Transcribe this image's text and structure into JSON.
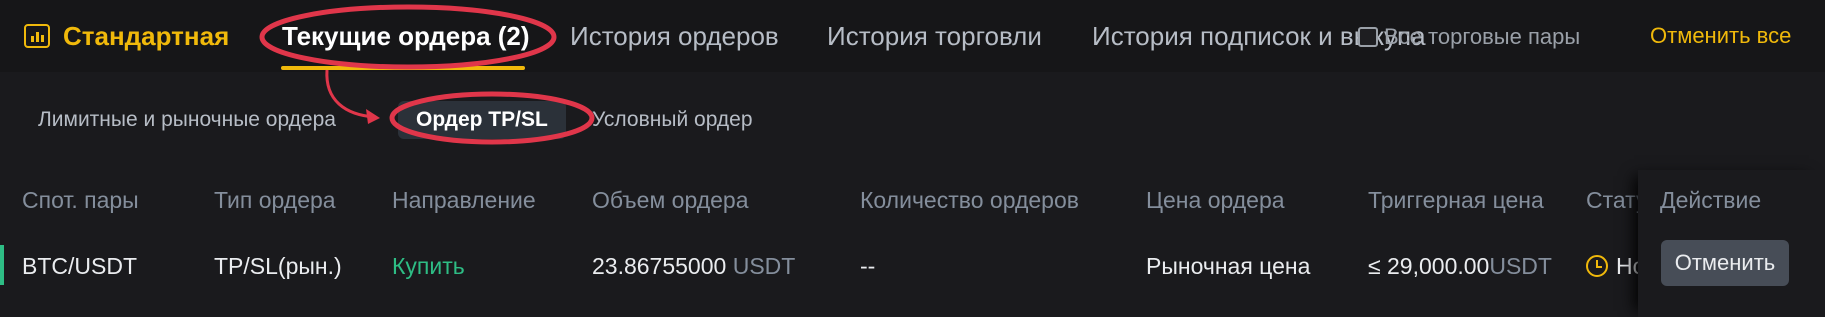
{
  "header": {
    "brand_icon": "chart-bars-icon",
    "brand_label": "Стандартная",
    "tabs": [
      {
        "label": "Текущие ордера (2)",
        "active": true
      },
      {
        "label": "История ордеров",
        "active": false
      },
      {
        "label": "История торговли",
        "active": false
      },
      {
        "label": "История подписок и выкупа",
        "active": false
      }
    ],
    "hide_pairs_label": "Все торговые пары",
    "cancel_all_label": "Отменить все"
  },
  "subtabs": [
    {
      "label": "Лимитные и рыночные ордера",
      "active": false
    },
    {
      "label": "Ордер TP/SL",
      "active": true
    },
    {
      "label": "Условный ордер",
      "active": false
    }
  ],
  "table": {
    "columns": [
      "Спот. пары",
      "Тип ордера",
      "Направление",
      "Объем ордера",
      "Количество ордеров",
      "Цена ордера",
      "Триггерная цена",
      "Статус",
      "Действие"
    ],
    "rows": [
      {
        "pair": "BTC/USDT",
        "type": "TP/SL(рын.)",
        "side": "Купить",
        "amount": "23.86755000",
        "amount_unit": "USDT",
        "quantity": "--",
        "price": "Рыночная цена",
        "trigger": "≤ 29,000.00",
        "trigger_unit": "USDT",
        "status": "Новый",
        "status_icon": "clock-icon",
        "action_label": "Отменить"
      }
    ]
  },
  "colors": {
    "background": "#1a1a1d",
    "accent": "#f0b90b",
    "buy": "#2ebd85",
    "annotation": "#e0364a"
  }
}
